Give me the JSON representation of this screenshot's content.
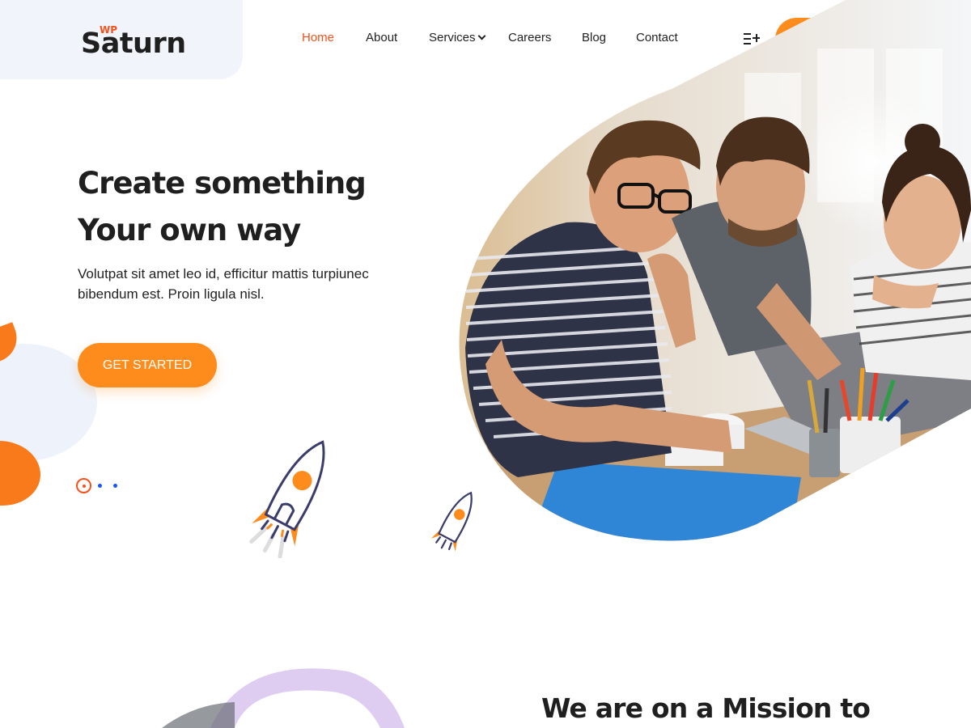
{
  "brand": {
    "prefix": "WP",
    "name": "Saturn"
  },
  "nav": {
    "items": [
      {
        "label": "Home",
        "active": true
      },
      {
        "label": "About"
      },
      {
        "label": "Services",
        "dropdown": true
      },
      {
        "label": "Careers"
      },
      {
        "label": "Blog"
      },
      {
        "label": "Contact"
      }
    ]
  },
  "header": {
    "menu_icon": "menu-plus-icon",
    "social": [
      {
        "icon": "facebook-icon"
      },
      {
        "icon": "instagram-icon"
      },
      {
        "icon": "linkedin-icon"
      },
      {
        "icon": "twitter-icon"
      }
    ]
  },
  "hero": {
    "title_line1": "Create something",
    "title_line2": "Your own way",
    "text": "Volutpat sit amet leo id, efficitur mattis turpiunec bibendum est. Proin ligula nisl.",
    "cta_label": "GET STARTED",
    "slides": {
      "count": 3,
      "active": 1
    }
  },
  "mission": {
    "heading": "We are on a Mission to"
  },
  "colors": {
    "accent": "#fd8c1c",
    "active_nav": "#f7501a",
    "dot_blue": "#1a56ff",
    "text": "#1f1f1f"
  }
}
